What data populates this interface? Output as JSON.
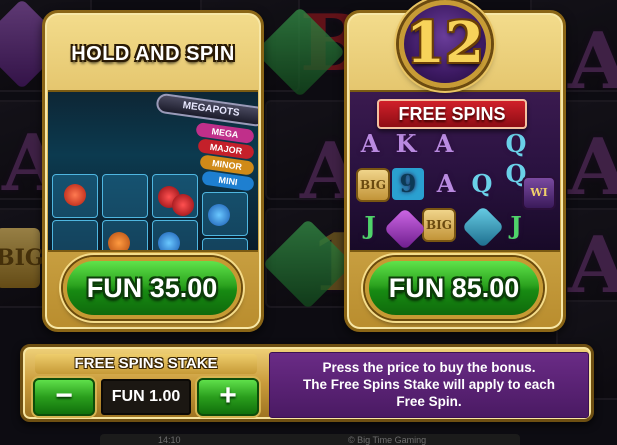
{
  "bonus_options": [
    {
      "title": "HOLD AND SPIN",
      "price": "FUN 35.00",
      "preview": {
        "banner": "MEGAPOTS",
        "jackpots": [
          "MEGA",
          "MAJOR",
          "MINOR",
          "MINI"
        ]
      }
    },
    {
      "title": "12",
      "subtitle": "FREE SPINS",
      "price": "FUN 85.00",
      "preview": {
        "tiles": [
          "A",
          "K",
          "A",
          "Q",
          "Q",
          "9",
          "A",
          "Q",
          "J",
          "J"
        ],
        "big_tile": "BIG",
        "wild_tile": "WI"
      }
    }
  ],
  "stake": {
    "label": "FREE SPINS STAKE",
    "minus": "−",
    "plus": "+",
    "value": "FUN 1.00"
  },
  "info": {
    "lines": [
      "Press the price to buy the bonus.",
      "The Free Spins Stake will apply to each",
      "Free Spin."
    ]
  },
  "status": {
    "time": "14:10",
    "brand": "© Big Time Gaming"
  },
  "background": {
    "letters": [
      "A",
      "A",
      "A",
      "A",
      "A",
      "B",
      "1",
      "A"
    ],
    "big_symbol": "BIG"
  },
  "colors": {
    "gold": "#d9b456",
    "green_button": "#2ca31f",
    "purple_info": "#5a2275",
    "red_banner": "#c0161f"
  }
}
